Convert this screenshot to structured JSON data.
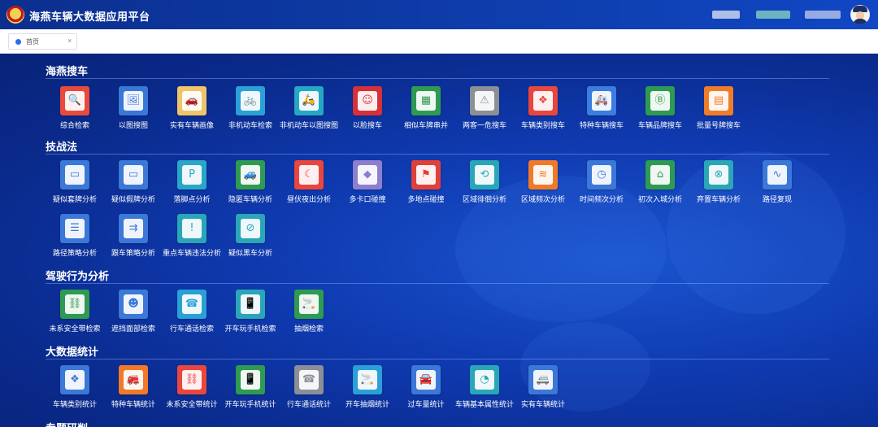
{
  "app": {
    "title": "海燕车辆大数据应用平台"
  },
  "tabs": [
    {
      "label": "首页",
      "close": "×"
    }
  ],
  "sections": [
    {
      "title": "海燕搜车",
      "items": [
        {
          "label": "综合检索",
          "icon": "search-record-icon",
          "color": "#e84a3f",
          "glyph": "🔍"
        },
        {
          "label": "以图搜图",
          "icon": "image-search-icon",
          "color": "#3a78d8",
          "glyph": "🖼"
        },
        {
          "label": "实有车辆画像",
          "icon": "car-portrait-icon",
          "color": "#f0c46a",
          "glyph": "🚗"
        },
        {
          "label": "非机动车检索",
          "icon": "bicycle-search-icon",
          "color": "#2aa0d8",
          "glyph": "🚲"
        },
        {
          "label": "非机动车以图搜图",
          "icon": "bicycle-image-search-icon",
          "color": "#25a7c6",
          "glyph": "🛵"
        },
        {
          "label": "以脸搜车",
          "icon": "face-search-icon",
          "color": "#d6303a",
          "glyph": "☺"
        },
        {
          "label": "相似车牌串并",
          "icon": "similar-plate-icon",
          "color": "#2f9a52",
          "glyph": "▦"
        },
        {
          "label": "两客一危搜车",
          "icon": "hazard-vehicle-icon",
          "color": "#8a8f98",
          "glyph": "⚠"
        },
        {
          "label": "车辆类别搜车",
          "icon": "vehicle-type-icon",
          "color": "#e8473f",
          "glyph": "❖"
        },
        {
          "label": "特种车辆搜车",
          "icon": "special-vehicle-icon",
          "color": "#3b7de0",
          "glyph": "🚑"
        },
        {
          "label": "车辆品牌搜车",
          "icon": "brand-search-icon",
          "color": "#2f9a52",
          "glyph": "Ⓑ"
        },
        {
          "label": "批量号牌搜车",
          "icon": "batch-plate-icon",
          "color": "#ee7d2a",
          "glyph": "▤"
        }
      ]
    },
    {
      "title": "技战法",
      "items": [
        {
          "label": "疑似套牌分析",
          "icon": "fake-plate-icon",
          "color": "#3b78d8",
          "glyph": "▭"
        },
        {
          "label": "疑似假牌分析",
          "icon": "false-plate-icon",
          "color": "#3b78d8",
          "glyph": "▭"
        },
        {
          "label": "落脚点分析",
          "icon": "parking-icon",
          "color": "#2aa6c8",
          "glyph": "P"
        },
        {
          "label": "隐匿车辆分析",
          "icon": "hidden-vehicle-icon",
          "color": "#2f9a52",
          "glyph": "🚙"
        },
        {
          "label": "昼伏夜出分析",
          "icon": "night-vehicle-icon",
          "color": "#e8473f",
          "glyph": "☾"
        },
        {
          "label": "多卡口碰撞",
          "icon": "multi-checkpoint-icon",
          "color": "#8c7fd0",
          "glyph": "◆"
        },
        {
          "label": "多地点碰撞",
          "icon": "multi-location-icon",
          "color": "#e0403c",
          "glyph": "⚑"
        },
        {
          "label": "区域徘徊分析",
          "icon": "area-loiter-icon",
          "color": "#2aa6b8",
          "glyph": "⟲"
        },
        {
          "label": "区域频次分析",
          "icon": "area-frequency-icon",
          "color": "#f07a2a",
          "glyph": "≋"
        },
        {
          "label": "时间频次分析",
          "icon": "time-frequency-icon",
          "color": "#3b78d8",
          "glyph": "◷"
        },
        {
          "label": "初次入城分析",
          "icon": "city-entry-icon",
          "color": "#2f9a52",
          "glyph": "⌂"
        },
        {
          "label": "弃置车辆分析",
          "icon": "abandoned-vehicle-icon",
          "color": "#2aa6b8",
          "glyph": "⊗"
        },
        {
          "label": "路径复现",
          "icon": "route-replay-icon",
          "color": "#3b78d8",
          "glyph": "∿"
        },
        {
          "label": "路径策略分析",
          "icon": "route-strategy-icon",
          "color": "#3b78d8",
          "glyph": "☰"
        },
        {
          "label": "跟车策略分析",
          "icon": "follow-car-icon",
          "color": "#3b78d8",
          "glyph": "⇉"
        },
        {
          "label": "重点车辆违法分析",
          "icon": "key-vehicle-violation-icon",
          "color": "#2aa6b8",
          "glyph": "!"
        },
        {
          "label": "疑似黑车分析",
          "icon": "black-car-icon",
          "color": "#2aa6b8",
          "glyph": "⊘"
        }
      ]
    },
    {
      "title": "驾驶行为分析",
      "items": [
        {
          "label": "未系安全带检索",
          "icon": "seatbelt-icon",
          "color": "#2f9a52",
          "glyph": "⛓"
        },
        {
          "label": "遮挡面部检索",
          "icon": "face-cover-icon",
          "color": "#3b78d8",
          "glyph": "☻"
        },
        {
          "label": "行车通话检索",
          "icon": "phone-call-icon",
          "color": "#2aa0d8",
          "glyph": "☎"
        },
        {
          "label": "开车玩手机检索",
          "icon": "phone-use-icon",
          "color": "#2aa6b8",
          "glyph": "📱"
        },
        {
          "label": "抽烟检索",
          "icon": "smoking-icon",
          "color": "#2f9a52",
          "glyph": "🚬"
        }
      ]
    },
    {
      "title": "大数据统计",
      "items": [
        {
          "label": "车辆类别统计",
          "icon": "vehicle-type-stats-icon",
          "color": "#3b78d8",
          "glyph": "❖"
        },
        {
          "label": "特种车辆统计",
          "icon": "special-vehicle-stats-icon",
          "color": "#f07a2a",
          "glyph": "🚒"
        },
        {
          "label": "未系安全带统计",
          "icon": "seatbelt-stats-icon",
          "color": "#e8473f",
          "glyph": "⛓"
        },
        {
          "label": "开车玩手机统计",
          "icon": "phone-use-stats-icon",
          "color": "#2f9a52",
          "glyph": "📱"
        },
        {
          "label": "行车通话统计",
          "icon": "phone-call-stats-icon",
          "color": "#8a8f98",
          "glyph": "☎"
        },
        {
          "label": "开车抽烟统计",
          "icon": "smoking-stats-icon",
          "color": "#2aa0d8",
          "glyph": "🚬"
        },
        {
          "label": "过车量统计",
          "icon": "traffic-volume-icon",
          "color": "#3b78d8",
          "glyph": "🚘"
        },
        {
          "label": "车辆基本属性统计",
          "icon": "vehicle-attribute-icon",
          "color": "#2aa6b8",
          "glyph": "◔"
        },
        {
          "label": "实有车辆统计",
          "icon": "actual-vehicle-stats-icon",
          "color": "#3b78d8",
          "glyph": "🚐"
        }
      ]
    },
    {
      "title": "专题研判",
      "items": []
    }
  ],
  "colors": {
    "topbar": "#0d3aa5",
    "background": "#0f3ab0",
    "accent": "#2f6bf0"
  }
}
